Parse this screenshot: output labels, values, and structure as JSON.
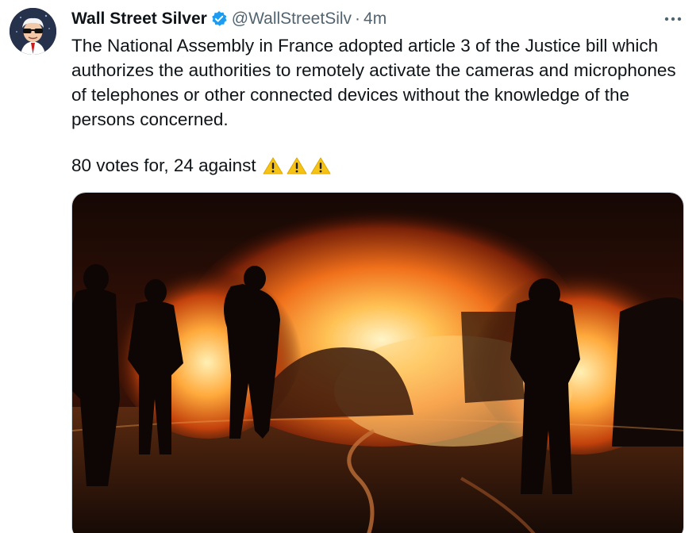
{
  "tweet": {
    "author": {
      "display_name": "Wall Street Silver",
      "handle": "@WallStreetSilv",
      "verified": true
    },
    "separator": "·",
    "timestamp": "4m",
    "text": "The National Assembly in France adopted article 3 of the Justice bill which authorizes the authorities to remotely activate the cameras and microphones of telephones or other connected devices without the knowledge of the persons concerned.",
    "votes_text": "80 votes for, 24 against",
    "emoji": [
      "warning-icon",
      "warning-icon",
      "warning-icon"
    ],
    "media": {
      "icon": "photo-burning-vehicles-firefighters"
    }
  },
  "colors": {
    "verified": "#1d9bf0",
    "secondary_text": "#536471",
    "primary_text": "#0f1419",
    "warning": "#f4c316"
  }
}
